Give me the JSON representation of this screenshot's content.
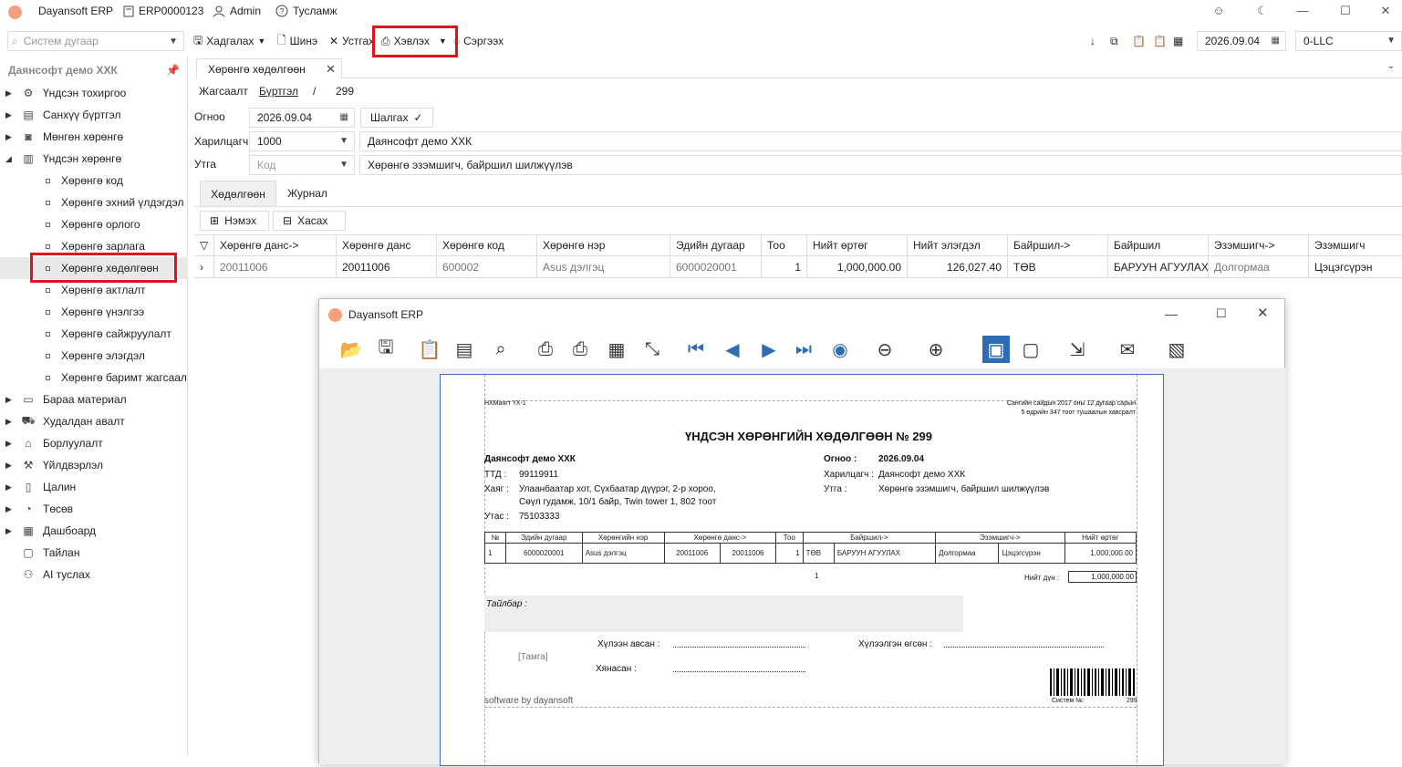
{
  "titlebar": {
    "app_name": "Dayansoft ERP",
    "database": "ERP0000123",
    "user": "Admin",
    "help": "Тусламж"
  },
  "toolbar": {
    "search_placeholder": "Систем дугаар",
    "save": "Хадгалах",
    "new": "Шинэ",
    "delete": "Устгах",
    "print": "Хэвлэх",
    "refresh": "Сэргээх",
    "date": "2026.09.04",
    "company_code": "0-LLC"
  },
  "sidebar": {
    "company": "Даянсофт демо ХХК",
    "items": [
      {
        "label": "Үндсэн тохиргоо",
        "icon": "gear-icon"
      },
      {
        "label": "Санхүү бүртгэл",
        "icon": "ledger-icon"
      },
      {
        "label": "Мөнгөн хөрөнгө",
        "icon": "cash-icon"
      },
      {
        "label": "Үндсэн хөрөнгө",
        "icon": "building-icon"
      }
    ],
    "subitems": [
      "Хөрөнгө код",
      "Хөрөнгө эхний үлдэгдэл",
      "Хөрөнгө орлого",
      "Хөрөнгө зарлага",
      "Хөрөнгө хөдөлгөөн",
      "Хөрөнгө актлалт",
      "Хөрөнгө үнэлгээ",
      "Хөрөнгө сайжруулалт",
      "Хөрөнгө элэгдэл",
      "Хөрөнгө баримт жагсаал"
    ],
    "items2": [
      {
        "label": "Бараа материал",
        "icon": "box-icon"
      },
      {
        "label": "Худалдан авалт",
        "icon": "cart-icon"
      },
      {
        "label": "Борлуулалт",
        "icon": "shop-icon"
      },
      {
        "label": "Үйлдвэрлэл",
        "icon": "factory-icon"
      },
      {
        "label": "Цалин",
        "icon": "wallet-icon"
      },
      {
        "label": "Төсөв",
        "icon": "pie-icon"
      },
      {
        "label": "Дашбоард",
        "icon": "chart-icon"
      },
      {
        "label": "Тайлан",
        "icon": "report-icon"
      },
      {
        "label": "AI туслах",
        "icon": "ai-icon"
      }
    ]
  },
  "document": {
    "tab_title": "Хөрөнгө хөдөлгөөн",
    "breadcrumb": {
      "list": "Жагсаалт",
      "register": "Бүртгэл",
      "sep": "/",
      "number": "299"
    },
    "date_label": "Огноо",
    "date_value": "2026.09.04",
    "check_button": "Шалгах",
    "partner_label": "Харилцагч",
    "partner_code": "1000",
    "partner_name": "Даянсофт демо ХХК",
    "note_label": "Утга",
    "note_code_placeholder": "Код",
    "note_text": "Хөрөнгө эзэмшигч, байршил шилжүүлэв",
    "tabs": [
      "Хөдөлгөөн",
      "Журнал"
    ],
    "add_button": "Нэмэх",
    "remove_button": "Хасах"
  },
  "grid": {
    "columns": [
      "Хөрөнгө данс->",
      "Хөрөнгө данс",
      "Хөрөнгө код",
      "Хөрөнгө нэр",
      "Эдийн дугаар",
      "Тоо",
      "Нийт өртөг",
      "Нийт элэгдэл",
      "Байршил->",
      "Байршил",
      "Эзэмшигч->",
      "Эзэмшигч"
    ],
    "rows": [
      [
        "20011006",
        "20011006",
        "600002",
        "Asus дэлгэц",
        "6000020001",
        "1",
        "1,000,000.00",
        "126,027.40",
        "ТӨВ",
        "БАРУУН АГУУЛАХ",
        "Долгормаа",
        "Цэцэгсүрэн"
      ]
    ]
  },
  "preview": {
    "title": "Dayansoft ERP",
    "report": {
      "form_code": "НХМаягт ҮХ-1",
      "decree_line1": "Сангийн сайдын 2017 оны 12 дугаар сарын",
      "decree_line2": "5 өдрийн 347 тоот тушаалын хавсралт",
      "heading": "ҮНДСЭН ХӨРӨНГИЙН ХӨДӨЛГӨӨН № 299",
      "company": "Даянсофт демо ХХК",
      "ttd_label": "ТТД :",
      "ttd": "99119911",
      "address_label": "Хаяг :",
      "address1": "Улаанбаатар хот, Сүхбаатар дүүрэг, 2-р хороо,",
      "address2": "Сөүл гудамж, 10/1 байр, Twin tower 1, 802 тоот",
      "phone_label": "Утас :",
      "phone": "75103333",
      "date_label": "Огноо :",
      "date": "2026.09.04",
      "partner_label": "Харилцагч :",
      "partner": "Даянсофт демо ХХК",
      "note_label": "Утга :",
      "note": "Хөрөнгө эзэмшигч, байршил шилжүүлэв",
      "table_headers": [
        "№",
        "Эдийн дугаар",
        "Хөрөнгийн нэр",
        "Хөрөнгө данс->",
        "Тоо",
        "Байршил->",
        "Эзэмшигч->",
        "Нийт өртөг"
      ],
      "table_row": [
        "1",
        "6000020001",
        "Asus дэлгэц",
        "20011006",
        "20011006",
        "1",
        "ТӨВ",
        "БАРУУН АГУУЛАХ",
        "Долгормаа",
        "Цэцэгсүрэн",
        "1,000,000.00"
      ],
      "total_qty": "1",
      "total_label": "Нийт дүн :",
      "total_value": "1,000,000.00",
      "remark_label": "Тайлбар :",
      "received_label": "Хүлээн авсан :",
      "handed_label": "Хүлээлгэн өгсөн :",
      "checked_label": "Хянасан :",
      "stamp": "[Тамга]",
      "footer": "software by dayansoft",
      "system_no_label": "Систем №:",
      "system_no": "299"
    }
  }
}
